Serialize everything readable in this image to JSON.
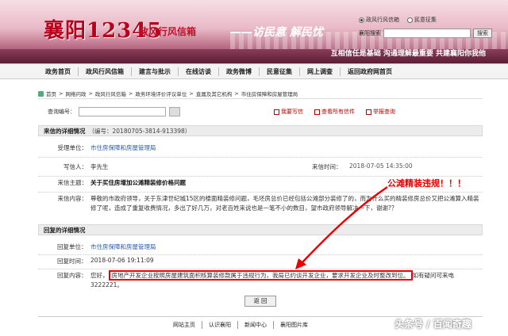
{
  "header": {
    "logo_main": "襄阳12345",
    "logo_sub": "政风行风信箱",
    "slogan": "——访民意 解民忧",
    "radio_options": [
      "政风行风信箱",
      "民意征集"
    ],
    "search_label": "襄阳搜索",
    "search_button": "搜索",
    "motto": "互相信任是基础 沟通理解最重要 共建襄阳你我他"
  },
  "nav": [
    "政务首页",
    "政风行风信箱",
    "建言与批示",
    "在线访谈",
    "政务微博",
    "民意征集",
    "网上调查",
    "返回政府网首页"
  ],
  "breadcrumb": [
    "首页",
    "网络问政",
    "政风行风信箱",
    "政务环境评价评议单位",
    "直属及其它机构",
    "市住房保障和房屋管理局"
  ],
  "query": {
    "label": "查询编号：",
    "actions": [
      "我要写信",
      "查看所有信件",
      "举报查询"
    ]
  },
  "letter": {
    "section_title": "来信的详细情况",
    "code": "（编号：20180705-3814-913398）",
    "unit_label": "受理单位：",
    "unit": "市住房保障和房屋管理局",
    "writer_label": "写信人：",
    "writer": "李先生",
    "time_label": "来信时间：",
    "time": "2018-07-05 14:35:00",
    "subject_label": "来信主题：",
    "subject": "关于买住房增加公滩精装修价格问题",
    "content_label": "来信内容：",
    "content": "尊敬的市政府领导，关于东津世纪城15区的楼面精装修问题，毛坯房总价已经包括公滩部分装修了的，而为什么买的精装修房总价又把公滩算入精装修了呢，造成了重复收费情况，多出了好几万，对老百姓来说也是一笔不小的数目，望市政府领导解决一下，谢谢?？"
  },
  "annotation": "公滩精装违规！！！",
  "reply": {
    "section_title": "回复的详细情况",
    "unit_label": "回复单位：",
    "unit": "市住房保障和房屋管理局",
    "time_label": "回复时间：",
    "time": "2018-07-06 19:11:09",
    "content_label": "回复内容：",
    "content_pre": "您好，",
    "content_highlight": "房地产开发企业按照房屋建筑面积核算装修款属于违规行为，我局已约谈开发企业，要求开发企业及时整改到位。",
    "content_post": "如有疑问可来电3222221。"
  },
  "back_button": "返 回",
  "footer": [
    "网站主页",
    "认识襄阳",
    "新闻中心",
    "襄阳图片库"
  ],
  "watermark": "头条号 / 百闻奇趣",
  "colors": {
    "accent_red": "#e00000",
    "link_blue": "#2b5aa8"
  }
}
